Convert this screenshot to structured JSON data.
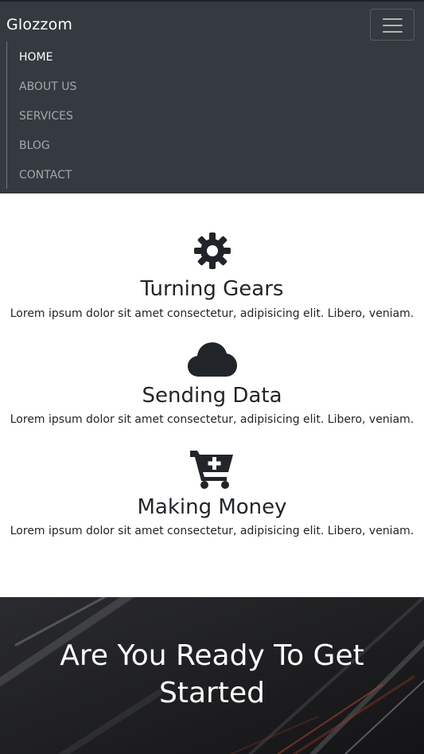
{
  "navbar": {
    "brand": "Glozzom",
    "toggler_icon": "hamburger-icon",
    "items": [
      {
        "label": "HOME",
        "active": true
      },
      {
        "label": "ABOUT US",
        "active": false
      },
      {
        "label": "SERVICES",
        "active": false
      },
      {
        "label": "BLOG",
        "active": false
      },
      {
        "label": "CONTACT",
        "active": false
      }
    ]
  },
  "features": [
    {
      "icon": "gear-icon",
      "title": "Turning Gears",
      "text": "Lorem ipsum dolor sit amet consectetur, adipisicing elit. Libero, veniam."
    },
    {
      "icon": "cloud-icon",
      "title": "Sending Data",
      "text": "Lorem ipsum dolor sit amet consectetur, adipisicing elit. Libero, veniam."
    },
    {
      "icon": "cart-plus-icon",
      "title": "Making Money",
      "text": "Lorem ipsum dolor sit amet consectetur, adipisicing elit. Libero, veniam."
    }
  ],
  "cta": {
    "heading": "Are You Ready To Get Started"
  },
  "colors": {
    "navbar_bg": "#343a40",
    "text_dark": "#212529",
    "nav_muted": "rgba(255,255,255,0.55)",
    "cta_bg": "#1a1a1c"
  }
}
